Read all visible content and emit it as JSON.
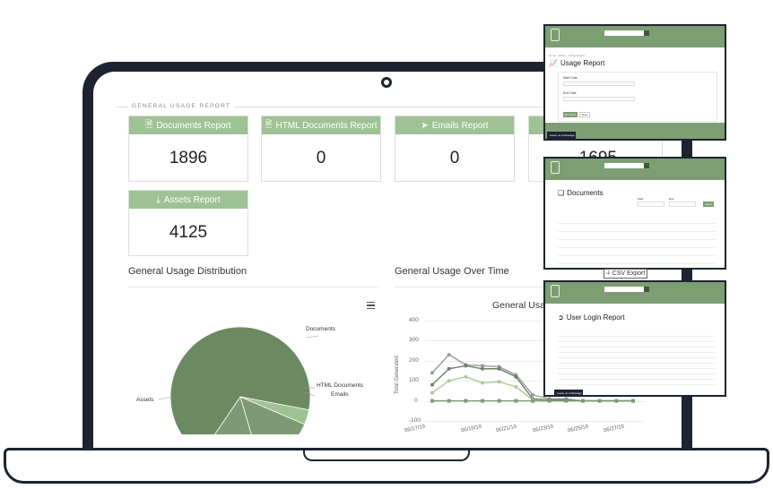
{
  "section": {
    "legend": "GENERAL USAGE REPORT"
  },
  "cards": [
    {
      "icon": "document-icon",
      "label": "Documents Report",
      "value": "1896"
    },
    {
      "icon": "html-document-icon",
      "label": "HTML Documents Report",
      "value": "0"
    },
    {
      "icon": "email-icon",
      "label": "Emails Report",
      "value": "0"
    },
    {
      "icon": "document-icon",
      "label": "",
      "value": "1695"
    },
    {
      "icon": "download-icon",
      "label": "Assets Report",
      "value": "4125"
    }
  ],
  "distribution": {
    "heading": "General Usage Distribution",
    "labels": {
      "documents": "Documents",
      "html": "HTML Documents",
      "emails": "Emails",
      "assets": "Assets"
    }
  },
  "over_time": {
    "heading": "General Usage Over Time",
    "chart_title": "General Usage Over Time",
    "ylabel": "Total Generated"
  },
  "chart_data": [
    {
      "type": "pie",
      "categories": [
        "Documents",
        "HTML Documents",
        "Emails",
        "Assets"
      ],
      "values": [
        1896,
        0,
        0,
        4125
      ],
      "colors": [
        "#9fc294",
        "#7d9a75",
        "#7d9a75",
        "#6b8a62"
      ]
    },
    {
      "type": "line",
      "title": "General Usage Over Time",
      "ylabel": "Total Generated",
      "ylim": [
        -100,
        400
      ],
      "yticks": [
        400,
        300,
        200,
        100,
        0,
        -100
      ],
      "x": [
        "06/17/19",
        "06/19/19",
        "06/21/19",
        "06/23/19",
        "06/25/19",
        "06/27/19"
      ],
      "series": [
        {
          "values": [
            140,
            230,
            180,
            175,
            170,
            130,
            30,
            10,
            10,
            0,
            0,
            0,
            0
          ],
          "color": "#9a9a9a"
        },
        {
          "values": [
            80,
            160,
            175,
            160,
            160,
            120,
            10,
            5,
            5,
            0,
            0,
            0,
            0
          ],
          "color": "#6e7f6a"
        },
        {
          "values": [
            40,
            100,
            120,
            90,
            95,
            70,
            5,
            0,
            0,
            0,
            0,
            0,
            0
          ],
          "color": "#a9cc9a"
        },
        {
          "values": [
            0,
            0,
            0,
            0,
            0,
            0,
            0,
            0,
            0,
            0,
            0,
            0,
            0
          ],
          "color": "#7d9a75"
        }
      ]
    }
  ],
  "thumbnails": [
    {
      "title": "Usage Report",
      "icon": "chart-icon",
      "fields": [
        "Start Date",
        "End Date"
      ],
      "button": "Run Report",
      "button2": "Reset",
      "chat": "Leave us a Message"
    },
    {
      "title": "Documents",
      "icon": "documents-icon",
      "filters": [
        "Start",
        "End"
      ],
      "button": "Export",
      "csv": "CSV Export"
    },
    {
      "title": "User Login Report",
      "icon": "login-icon",
      "chat": "Leave us a Message"
    }
  ]
}
